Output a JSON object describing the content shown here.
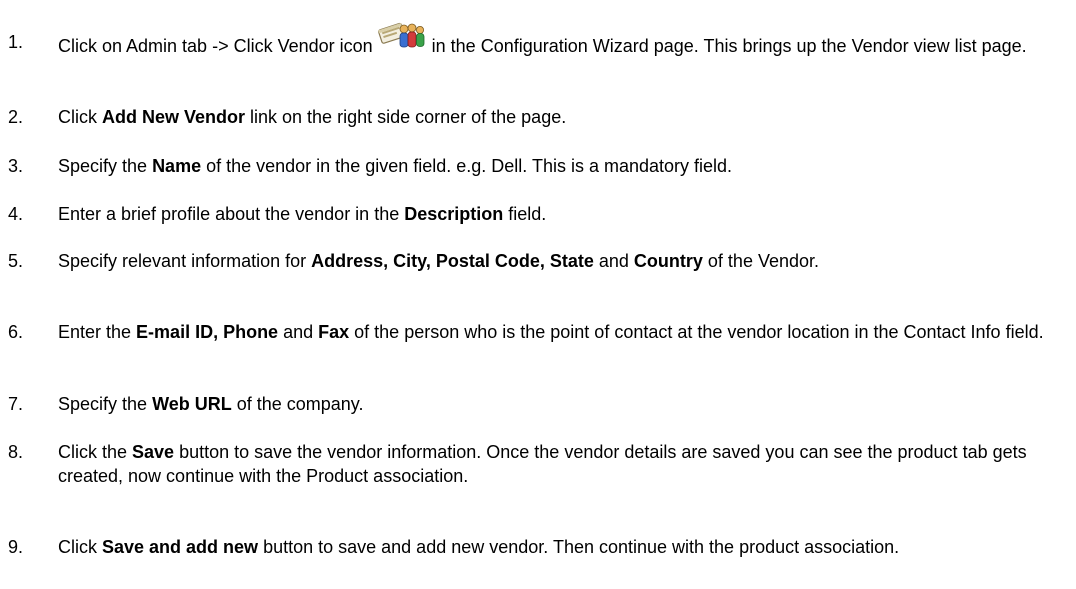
{
  "steps": [
    {
      "number": "1.",
      "parts": [
        "Click on Admin tab -> Click Vendor icon",
        " in the Configuration Wizard page. This brings up the Vendor view list page."
      ],
      "icon": "vendor-icon"
    },
    {
      "number": "2.",
      "parts": [
        "Click ",
        "Add New Vendor",
        " link on the right side corner of the page."
      ]
    },
    {
      "number": "3.",
      "parts": [
        "Specify the ",
        "Name",
        " of the vendor in the given field. e.g. Dell. This is a mandatory field."
      ]
    },
    {
      "number": "4.",
      "parts": [
        "Enter a brief profile about the vendor in the ",
        "Description",
        " field."
      ]
    },
    {
      "number": "5.",
      "parts": [
        "Specify relevant information for ",
        "Address, City, Postal Code, State",
        " and ",
        "Country",
        " of the Vendor."
      ]
    },
    {
      "number": "6.",
      "parts": [
        "Enter the ",
        "E-mail ID, Phone",
        " and ",
        "Fax",
        " of the person who is the point of contact at the vendor location in the Contact Info field."
      ]
    },
    {
      "number": "7.",
      "parts": [
        "Specify the ",
        "Web URL",
        " of the company."
      ]
    },
    {
      "number": "8.",
      "parts": [
        "Click the ",
        "Save",
        " button to save the vendor information. Once the vendor details are saved you can see the product tab gets created, now continue with the Product association."
      ]
    },
    {
      "number": "9.",
      "parts": [
        "Click ",
        "Save and add new",
        " button to save and add new vendor. Then continue with the product association."
      ]
    }
  ]
}
